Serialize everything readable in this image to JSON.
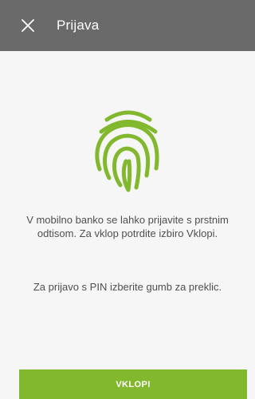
{
  "header": {
    "title": "Prijava",
    "close_icon": "close-icon"
  },
  "main": {
    "icon": "fingerprint-icon",
    "accent_color": "#82b82e",
    "message_primary": "V mobilno banko se lahko prijavite s prstnim odtisom. Za vklop potrdite izbiro Vklopi.",
    "message_secondary": "Za prijavo s PIN izberite gumb za preklic."
  },
  "footer": {
    "enable_button_label": "VKLOPI"
  }
}
